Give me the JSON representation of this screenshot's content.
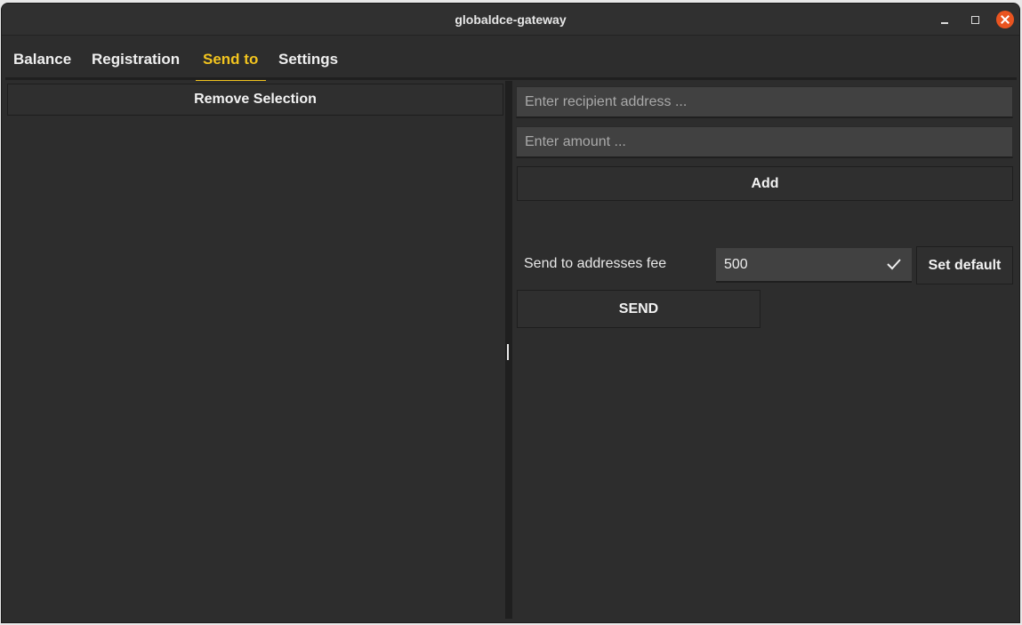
{
  "window": {
    "title": "globaldce-gateway"
  },
  "tabs": [
    {
      "label": "Balance"
    },
    {
      "label": "Registration"
    },
    {
      "label": "Send to",
      "active": true
    },
    {
      "label": "Settings"
    }
  ],
  "left_pane": {
    "remove_selection_label": "Remove Selection"
  },
  "right_pane": {
    "recipient_placeholder": "Enter recipient address ...",
    "amount_placeholder": "Enter amount ...",
    "add_label": "Add",
    "fee_label": "Send to addresses fee",
    "fee_value": "500",
    "set_default_label": "Set default",
    "send_label": "SEND"
  },
  "colors": {
    "accent": "#f2c41f",
    "close_button": "#e95420",
    "background": "#2d2d2d"
  }
}
